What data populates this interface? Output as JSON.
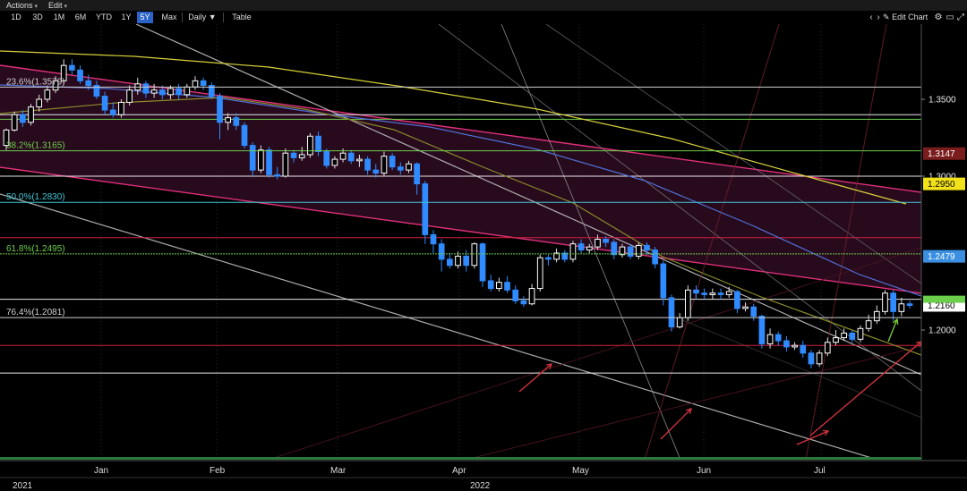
{
  "menu": {
    "actions": "Actions",
    "edit": "Edit"
  },
  "toolbar": {
    "ranges": [
      "1D",
      "3D",
      "1M",
      "6M",
      "YTD",
      "1Y",
      "5Y",
      "Max"
    ],
    "active_range": "5Y",
    "interval": "Daily ▼",
    "table": "Table",
    "nav_prev": "‹",
    "nav_next": "›",
    "edit_chart": "Edit Chart",
    "icon_names": [
      "pencil-icon",
      "settings-icon",
      "expand-icon",
      "fullscreen-icon"
    ]
  },
  "chart_data": {
    "type": "candlestick",
    "title": "",
    "xlabel": "",
    "ylabel": "",
    "ylim": [
      1.16,
      1.385
    ],
    "yticks": [
      "1.3500",
      "1.3000",
      "1.2000"
    ],
    "xaxis_months": [
      "Jan",
      "Feb",
      "Mar",
      "Apr",
      "May",
      "Jun",
      "Jul"
    ],
    "xaxis_years": [
      "2021",
      "2022"
    ],
    "price_labels": [
      {
        "text": "1.3147",
        "value": 1.3147,
        "bg": "#7a1c1c",
        "fg": "#ffffff"
      },
      {
        "text": "1.2950",
        "value": 1.295,
        "bg": "#f2e21a",
        "fg": "#000000"
      },
      {
        "text": "1.2479",
        "value": 1.2479,
        "bg": "#3a8fe0",
        "fg": "#ffffff"
      },
      {
        "text": "1.2160",
        "value": 1.216,
        "bg": "#ffffff",
        "fg": "#000000"
      }
    ],
    "fibonacci": [
      {
        "label": "23.6%(1.3579)",
        "value": 1.3579,
        "color": "#cfcfcf"
      },
      {
        "label": "38.2%(1.3165)",
        "value": 1.3165,
        "color": "#6ccf4c"
      },
      {
        "label": "50.0%(1.2830)",
        "value": 1.283,
        "color": "#3fc6d8"
      },
      {
        "label": "61.8%(1.2495)",
        "value": 1.2495,
        "color": "#6ccf4c"
      },
      {
        "label": "76.4%(1.2081)",
        "value": 1.2081,
        "color": "#cfcfcf"
      }
    ],
    "horizontal_levels": [
      {
        "value": 1.34,
        "color": "#e8e8e8"
      },
      {
        "value": 1.337,
        "color": "#6ccf4c"
      },
      {
        "value": 1.3,
        "color": "#e8e8e8"
      },
      {
        "value": 1.26,
        "color": "#d02040"
      },
      {
        "value": 1.22,
        "color": "#e8e8e8"
      },
      {
        "value": 1.19,
        "color": "#d02040"
      },
      {
        "value": 1.172,
        "color": "#e8e8e8"
      }
    ],
    "candles": [
      [
        1.32,
        1.33,
        1.317,
        1.331
      ],
      [
        1.33,
        1.34,
        1.329,
        1.342
      ],
      [
        1.34,
        1.335,
        1.332,
        1.343
      ],
      [
        1.335,
        1.345,
        1.333,
        1.347
      ],
      [
        1.345,
        1.35,
        1.342,
        1.353
      ],
      [
        1.35,
        1.356,
        1.348,
        1.359
      ],
      [
        1.356,
        1.362,
        1.354,
        1.365
      ],
      [
        1.362,
        1.372,
        1.36,
        1.376
      ],
      [
        1.372,
        1.369,
        1.366,
        1.376
      ],
      [
        1.369,
        1.362,
        1.36,
        1.372
      ],
      [
        1.362,
        1.359,
        1.356,
        1.366
      ],
      [
        1.359,
        1.352,
        1.35,
        1.362
      ],
      [
        1.352,
        1.343,
        1.34,
        1.355
      ],
      [
        1.343,
        1.34,
        1.338,
        1.348
      ],
      [
        1.34,
        1.348,
        1.338,
        1.35
      ],
      [
        1.348,
        1.356,
        1.346,
        1.359
      ],
      [
        1.356,
        1.36,
        1.353,
        1.364
      ],
      [
        1.36,
        1.354,
        1.351,
        1.362
      ],
      [
        1.354,
        1.356,
        1.351,
        1.36
      ],
      [
        1.356,
        1.353,
        1.35,
        1.359
      ],
      [
        1.353,
        1.357,
        1.35,
        1.359
      ],
      [
        1.357,
        1.353,
        1.35,
        1.36
      ],
      [
        1.353,
        1.358,
        1.351,
        1.36
      ],
      [
        1.358,
        1.362,
        1.356,
        1.365
      ],
      [
        1.362,
        1.359,
        1.356,
        1.364
      ],
      [
        1.359,
        1.352,
        1.35,
        1.361
      ],
      [
        1.352,
        1.335,
        1.324,
        1.354
      ],
      [
        1.335,
        1.338,
        1.33,
        1.341
      ],
      [
        1.338,
        1.333,
        1.33,
        1.341
      ],
      [
        1.333,
        1.32,
        1.318,
        1.335
      ],
      [
        1.32,
        1.304,
        1.3,
        1.322
      ],
      [
        1.304,
        1.317,
        1.302,
        1.32
      ],
      [
        1.317,
        1.301,
        1.299,
        1.319
      ],
      [
        1.301,
        1.3,
        1.298,
        1.306
      ],
      [
        1.3,
        1.315,
        1.299,
        1.318
      ],
      [
        1.315,
        1.312,
        1.309,
        1.317
      ],
      [
        1.312,
        1.314,
        1.31,
        1.319
      ],
      [
        1.314,
        1.326,
        1.312,
        1.328
      ],
      [
        1.326,
        1.316,
        1.313,
        1.329
      ],
      [
        1.316,
        1.307,
        1.305,
        1.318
      ],
      [
        1.307,
        1.311,
        1.305,
        1.313
      ],
      [
        1.311,
        1.315,
        1.309,
        1.318
      ],
      [
        1.315,
        1.31,
        1.308,
        1.317
      ],
      [
        1.31,
        1.311,
        1.306,
        1.314
      ],
      [
        1.311,
        1.304,
        1.301,
        1.313
      ],
      [
        1.304,
        1.302,
        1.299,
        1.308
      ],
      [
        1.302,
        1.313,
        1.3,
        1.316
      ],
      [
        1.313,
        1.306,
        1.304,
        1.315
      ],
      [
        1.306,
        1.304,
        1.301,
        1.309
      ],
      [
        1.304,
        1.308,
        1.302,
        1.31
      ],
      [
        1.308,
        1.295,
        1.288,
        1.309
      ],
      [
        1.295,
        1.262,
        1.256,
        1.297
      ],
      [
        1.262,
        1.256,
        1.25,
        1.265
      ],
      [
        1.256,
        1.246,
        1.238,
        1.259
      ],
      [
        1.246,
        1.242,
        1.24,
        1.25
      ],
      [
        1.242,
        1.248,
        1.24,
        1.251
      ],
      [
        1.248,
        1.242,
        1.238,
        1.252
      ],
      [
        1.242,
        1.256,
        1.24,
        1.257
      ],
      [
        1.256,
        1.232,
        1.228,
        1.257
      ],
      [
        1.232,
        1.227,
        1.225,
        1.236
      ],
      [
        1.227,
        1.231,
        1.225,
        1.234
      ],
      [
        1.231,
        1.226,
        1.224,
        1.235
      ],
      [
        1.226,
        1.219,
        1.217,
        1.229
      ],
      [
        1.219,
        1.217,
        1.215,
        1.222
      ],
      [
        1.217,
        1.227,
        1.216,
        1.23
      ],
      [
        1.227,
        1.247,
        1.225,
        1.249
      ],
      [
        1.247,
        1.246,
        1.242,
        1.249
      ],
      [
        1.246,
        1.25,
        1.244,
        1.253
      ],
      [
        1.25,
        1.246,
        1.244,
        1.252
      ],
      [
        1.246,
        1.256,
        1.244,
        1.258
      ],
      [
        1.256,
        1.252,
        1.25,
        1.259
      ],
      [
        1.252,
        1.254,
        1.25,
        1.256
      ],
      [
        1.254,
        1.259,
        1.252,
        1.262
      ],
      [
        1.259,
        1.257,
        1.254,
        1.261
      ],
      [
        1.257,
        1.249,
        1.246,
        1.259
      ],
      [
        1.249,
        1.254,
        1.247,
        1.256
      ],
      [
        1.254,
        1.248,
        1.246,
        1.256
      ],
      [
        1.248,
        1.255,
        1.246,
        1.257
      ],
      [
        1.255,
        1.252,
        1.249,
        1.257
      ],
      [
        1.252,
        1.243,
        1.24,
        1.254
      ],
      [
        1.243,
        1.221,
        1.216,
        1.245
      ],
      [
        1.221,
        1.202,
        1.199,
        1.223
      ],
      [
        1.202,
        1.208,
        1.201,
        1.211
      ],
      [
        1.208,
        1.226,
        1.206,
        1.229
      ],
      [
        1.226,
        1.224,
        1.22,
        1.229
      ],
      [
        1.224,
        1.223,
        1.22,
        1.227
      ],
      [
        1.223,
        1.224,
        1.22,
        1.227
      ],
      [
        1.224,
        1.223,
        1.22,
        1.227
      ],
      [
        1.223,
        1.225,
        1.221,
        1.228
      ],
      [
        1.225,
        1.214,
        1.211,
        1.226
      ],
      [
        1.214,
        1.215,
        1.212,
        1.218
      ],
      [
        1.215,
        1.209,
        1.206,
        1.217
      ],
      [
        1.209,
        1.191,
        1.188,
        1.21
      ],
      [
        1.191,
        1.197,
        1.188,
        1.201
      ],
      [
        1.197,
        1.193,
        1.19,
        1.199
      ],
      [
        1.193,
        1.189,
        1.186,
        1.196
      ],
      [
        1.189,
        1.19,
        1.187,
        1.192
      ],
      [
        1.19,
        1.185,
        1.182,
        1.193
      ],
      [
        1.185,
        1.178,
        1.175,
        1.187
      ],
      [
        1.178,
        1.185,
        1.176,
        1.187
      ],
      [
        1.185,
        1.192,
        1.183,
        1.195
      ],
      [
        1.192,
        1.195,
        1.19,
        1.2
      ],
      [
        1.195,
        1.198,
        1.193,
        1.201
      ],
      [
        1.198,
        1.194,
        1.192,
        1.2
      ],
      [
        1.194,
        1.201,
        1.192,
        1.203
      ],
      [
        1.201,
        1.206,
        1.199,
        1.21
      ],
      [
        1.206,
        1.212,
        1.204,
        1.216
      ],
      [
        1.212,
        1.224,
        1.21,
        1.226
      ],
      [
        1.224,
        1.212,
        1.206,
        1.226
      ],
      [
        1.212,
        1.217,
        1.209,
        1.221
      ],
      [
        1.217,
        1.216,
        1.214,
        1.219
      ]
    ]
  }
}
